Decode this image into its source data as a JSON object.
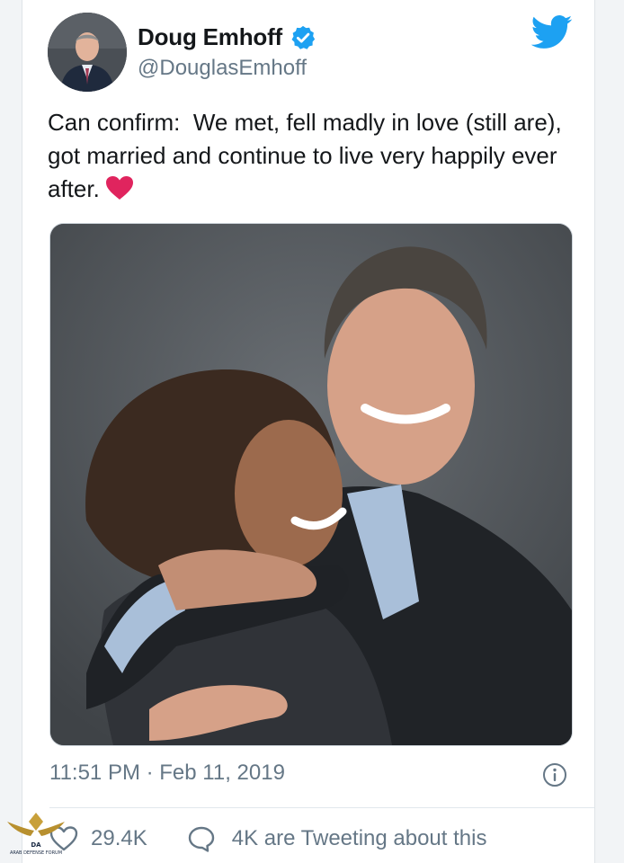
{
  "tweet": {
    "author": {
      "display_name": "Doug Emhoff",
      "handle": "@DouglasEmhoff",
      "verified": true
    },
    "text": "Can confirm:  We met, fell madly in love (still are), got married and continue to live very happily ever after.",
    "emoji": "red-heart",
    "timestamp": "11:51 PM · Feb 11, 2019",
    "likes": "29.4K",
    "tweeting_label": "4K are Tweeting about this"
  },
  "colors": {
    "brand_blue": "#1da1f2",
    "heart_red": "#e0245e",
    "secondary_text": "#657786"
  },
  "icons": {
    "logo": "twitter-bird-icon",
    "verified": "verified-badge-icon",
    "info": "info-icon",
    "like": "heart-outline-icon",
    "reply": "speech-bubble-icon"
  },
  "watermark": {
    "label": "ARAB DEFENSE FORUM"
  }
}
